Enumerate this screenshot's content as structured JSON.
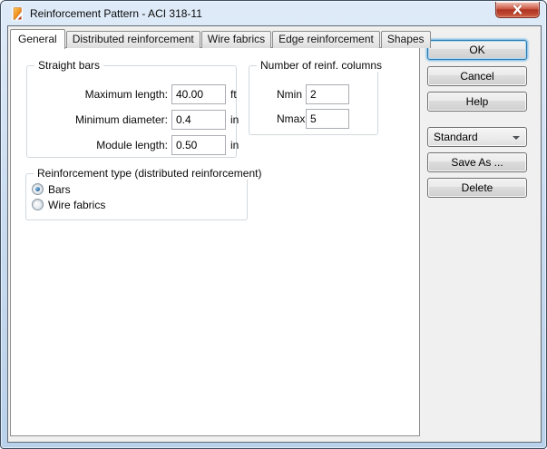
{
  "window": {
    "title": "Reinforcement Pattern - ACI 318-11"
  },
  "tabs": {
    "items": [
      {
        "label": "General",
        "active": true
      },
      {
        "label": "Distributed reinforcement",
        "active": false
      },
      {
        "label": "Wire fabrics",
        "active": false
      },
      {
        "label": "Edge reinforcement",
        "active": false
      },
      {
        "label": "Shapes",
        "active": false
      }
    ]
  },
  "general": {
    "straight_bars": {
      "legend": "Straight bars",
      "rows": [
        {
          "label": "Maximum length:",
          "value": "40.00",
          "unit": "ft"
        },
        {
          "label": "Minimum diameter:",
          "value": "0.4",
          "unit": "in"
        },
        {
          "label": "Module length:",
          "value": "0.50",
          "unit": "in"
        }
      ]
    },
    "reinf_columns": {
      "legend": "Number of reinf. columns",
      "rows": [
        {
          "label": "Nmin",
          "value": "2"
        },
        {
          "label": "Nmax",
          "value": "5"
        }
      ]
    },
    "reinf_type": {
      "legend": "Reinforcement type (distributed reinforcement)",
      "options": [
        {
          "label": "Bars",
          "selected": true
        },
        {
          "label": "Wire fabrics",
          "selected": false
        }
      ]
    }
  },
  "buttons": {
    "ok": "OK",
    "cancel": "Cancel",
    "help": "Help",
    "save_as": "Save As ...",
    "delete": "Delete"
  },
  "preset_combo": {
    "value": "Standard"
  },
  "colors": {
    "titlebar_blue": "#cadcf1",
    "dialog_bg": "#f0f0f0",
    "close_button_red": "#b83a26",
    "default_button_focus": "#56ace4",
    "radio_selected_blue": "#3a76ac"
  }
}
